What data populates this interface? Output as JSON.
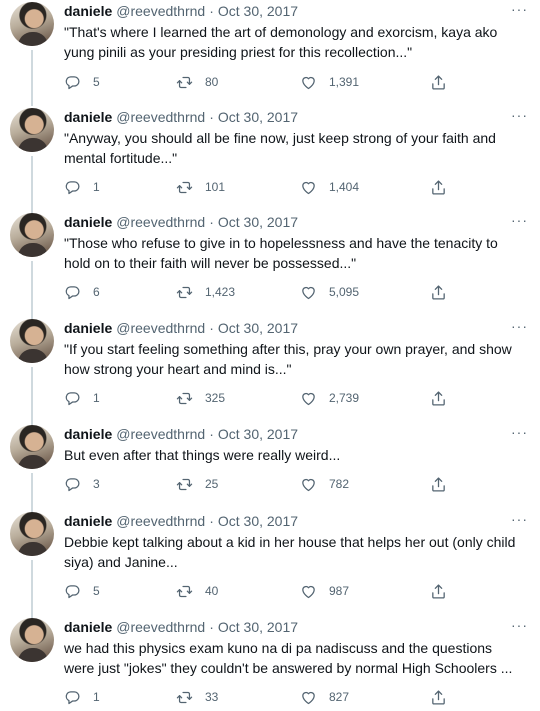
{
  "tweets": [
    {
      "name": "daniele",
      "handle": "@reevedthrnd",
      "separator": "·",
      "date": "Oct 30, 2017",
      "more": "···",
      "text": "\"That's where I learned the art of demonology and exorcism, kaya ako yung pinili as your presiding priest for this recollection...\"",
      "replies": "5",
      "retweets": "80",
      "likes": "1,391"
    },
    {
      "name": "daniele",
      "handle": "@reevedthrnd",
      "separator": "·",
      "date": "Oct 30, 2017",
      "more": "···",
      "text": "\"Anyway, you should all be fine now, just keep strong of your faith and mental fortitude...\"",
      "replies": "1",
      "retweets": "101",
      "likes": "1,404"
    },
    {
      "name": "daniele",
      "handle": "@reevedthrnd",
      "separator": "·",
      "date": "Oct 30, 2017",
      "more": "···",
      "text": "\"Those who refuse to give in to hopelessness and have the tenacity to hold on to their faith will never be possessed...\"",
      "replies": "6",
      "retweets": "1,423",
      "likes": "5,095"
    },
    {
      "name": "daniele",
      "handle": "@reevedthrnd",
      "separator": "·",
      "date": "Oct 30, 2017",
      "more": "···",
      "text": "\"If you start feeling something after this, pray your own prayer, and show how strong your heart and mind is...\"",
      "replies": "1",
      "retweets": "325",
      "likes": "2,739"
    },
    {
      "name": "daniele",
      "handle": "@reevedthrnd",
      "separator": "·",
      "date": "Oct 30, 2017",
      "more": "···",
      "text": "But even after that things were really weird...",
      "replies": "3",
      "retweets": "25",
      "likes": "782"
    },
    {
      "name": "daniele",
      "handle": "@reevedthrnd",
      "separator": "·",
      "date": "Oct 30, 2017",
      "more": "···",
      "text": "Debbie kept talking about a kid in her house that helps her out (only child siya) and Janine...",
      "replies": "5",
      "retweets": "40",
      "likes": "987"
    },
    {
      "name": "daniele",
      "handle": "@reevedthrnd",
      "separator": "·",
      "date": "Oct 30, 2017",
      "more": "···",
      "text": "we had this physics exam kuno na di pa nadiscuss and the questions were just \"jokes\" they couldn't be answered by normal High Schoolers ...",
      "replies": "1",
      "retweets": "33",
      "likes": "827"
    }
  ],
  "icons": {
    "reply": "reply-icon",
    "retweet": "retweet-icon",
    "like": "heart-icon",
    "share": "share-icon",
    "more": "more-options-icon"
  },
  "colors": {
    "text": "#0f1419",
    "muted": "#536471",
    "thread_line": "#cfd9de",
    "background": "#ffffff"
  }
}
